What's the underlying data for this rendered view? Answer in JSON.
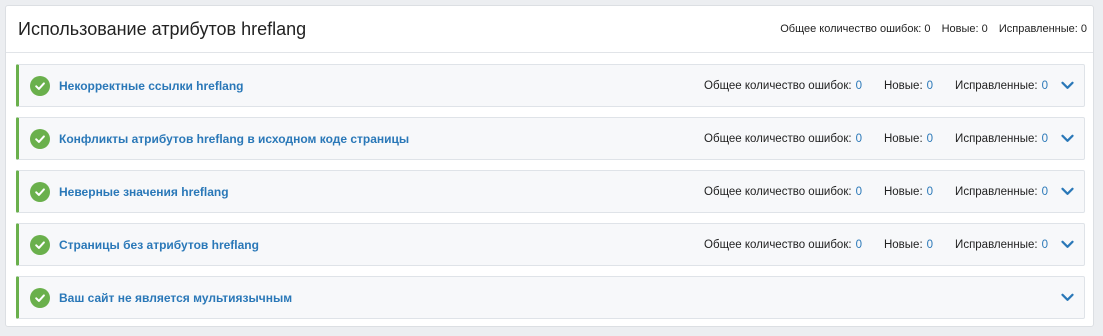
{
  "header": {
    "title": "Использование атрибутов hreflang",
    "stats": [
      {
        "label": "Общее количество ошибок:",
        "value": "0"
      },
      {
        "label": "Новые:",
        "value": "0"
      },
      {
        "label": "Исправленные:",
        "value": "0"
      }
    ]
  },
  "rows": [
    {
      "title": "Некорректные ссылки hreflang",
      "stats": [
        {
          "label": "Общее количество ошибок:",
          "value": "0"
        },
        {
          "label": "Новые:",
          "value": "0"
        },
        {
          "label": "Исправленные:",
          "value": "0"
        }
      ]
    },
    {
      "title": "Конфликты атрибутов hreflang в исходном коде страницы",
      "stats": [
        {
          "label": "Общее количество ошибок:",
          "value": "0"
        },
        {
          "label": "Новые:",
          "value": "0"
        },
        {
          "label": "Исправленные:",
          "value": "0"
        }
      ]
    },
    {
      "title": "Неверные значения hreflang",
      "stats": [
        {
          "label": "Общее количество ошибок:",
          "value": "0"
        },
        {
          "label": "Новые:",
          "value": "0"
        },
        {
          "label": "Исправленные:",
          "value": "0"
        }
      ]
    },
    {
      "title": "Страницы без атрибутов hreflang",
      "stats": [
        {
          "label": "Общее количество ошибок:",
          "value": "0"
        },
        {
          "label": "Новые:",
          "value": "0"
        },
        {
          "label": "Исправленные:",
          "value": "0"
        }
      ]
    },
    {
      "title": "Ваш сайт не является мультиязычным",
      "stats": []
    }
  ],
  "icons": {
    "status": "check-circle-icon",
    "expand": "chevron-down-icon"
  },
  "colors": {
    "accent_green": "#6ab04c",
    "link_blue": "#2a78b8"
  }
}
